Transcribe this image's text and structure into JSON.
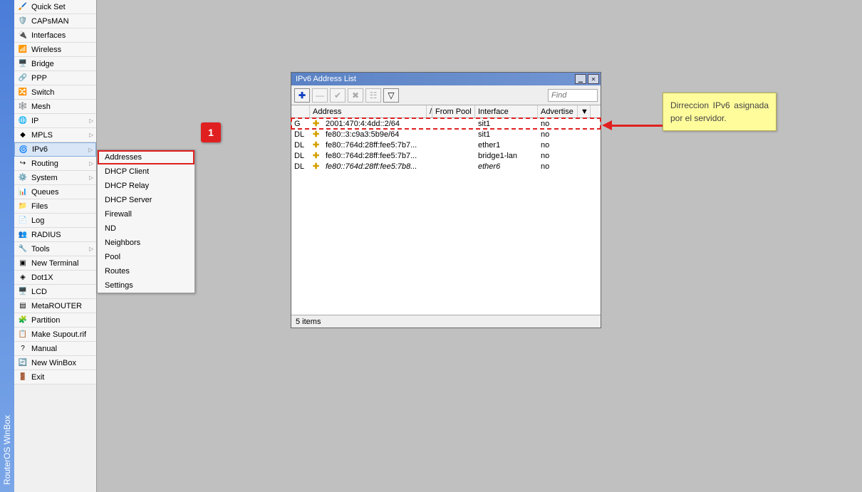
{
  "app_title": "RouterOS WinBox",
  "menu": {
    "items": [
      {
        "label": "Quick Set",
        "icon": "🖌️",
        "arrow": false
      },
      {
        "label": "CAPsMAN",
        "icon": "🛡️",
        "arrow": false
      },
      {
        "label": "Interfaces",
        "icon": "🔌",
        "arrow": false
      },
      {
        "label": "Wireless",
        "icon": "📶",
        "arrow": false
      },
      {
        "label": "Bridge",
        "icon": "🖥️",
        "arrow": false
      },
      {
        "label": "PPP",
        "icon": "🔗",
        "arrow": false
      },
      {
        "label": "Switch",
        "icon": "🔀",
        "arrow": false
      },
      {
        "label": "Mesh",
        "icon": "🕸️",
        "arrow": false
      },
      {
        "label": "IP",
        "icon": "🌐",
        "arrow": true
      },
      {
        "label": "MPLS",
        "icon": "◆",
        "arrow": true
      },
      {
        "label": "IPv6",
        "icon": "🌀",
        "arrow": true
      },
      {
        "label": "Routing",
        "icon": "↪",
        "arrow": true
      },
      {
        "label": "System",
        "icon": "⚙️",
        "arrow": true
      },
      {
        "label": "Queues",
        "icon": "📊",
        "arrow": false
      },
      {
        "label": "Files",
        "icon": "📁",
        "arrow": false
      },
      {
        "label": "Log",
        "icon": "📄",
        "arrow": false
      },
      {
        "label": "RADIUS",
        "icon": "👥",
        "arrow": false
      },
      {
        "label": "Tools",
        "icon": "🔧",
        "arrow": true
      },
      {
        "label": "New Terminal",
        "icon": "▣",
        "arrow": false
      },
      {
        "label": "Dot1X",
        "icon": "◈",
        "arrow": false
      },
      {
        "label": "LCD",
        "icon": "🖥️",
        "arrow": false
      },
      {
        "label": "MetaROUTER",
        "icon": "▤",
        "arrow": false
      },
      {
        "label": "Partition",
        "icon": "🧩",
        "arrow": false
      },
      {
        "label": "Make Supout.rif",
        "icon": "📋",
        "arrow": false
      },
      {
        "label": "Manual",
        "icon": "?",
        "arrow": false
      },
      {
        "label": "New WinBox",
        "icon": "🔄",
        "arrow": false
      },
      {
        "label": "Exit",
        "icon": "🚪",
        "arrow": false
      }
    ]
  },
  "submenu": {
    "items": [
      "Addresses",
      "DHCP Client",
      "DHCP Relay",
      "DHCP Server",
      "Firewall",
      "ND",
      "Neighbors",
      "Pool",
      "Routes",
      "Settings"
    ]
  },
  "marker": "1",
  "window": {
    "title": "IPv6 Address List",
    "find_placeholder": "Find",
    "columns": {
      "address": "Address",
      "from_pool": "From Pool",
      "interface": "Interface",
      "advertise": "Advertise"
    },
    "toolbar": {
      "add": "✚",
      "remove": "—",
      "enable": "✔",
      "disable": "✖",
      "comment": "☷",
      "filter": "▽"
    },
    "rows": [
      {
        "flag": "G",
        "address": "2001:470:4:4dd::2/64",
        "from_pool": "",
        "interface": "sit1",
        "advertise": "no",
        "highlight": true,
        "italic": false
      },
      {
        "flag": "DL",
        "address": "fe80::3:c9a3:5b9e/64",
        "from_pool": "",
        "interface": "sit1",
        "advertise": "no",
        "highlight": false,
        "italic": false
      },
      {
        "flag": "DL",
        "address": "fe80::764d:28ff:fee5:7b7...",
        "from_pool": "",
        "interface": "ether1",
        "advertise": "no",
        "highlight": false,
        "italic": false
      },
      {
        "flag": "DL",
        "address": "fe80::764d:28ff:fee5:7b7...",
        "from_pool": "",
        "interface": "bridge1-lan",
        "advertise": "no",
        "highlight": false,
        "italic": false
      },
      {
        "flag": "DL",
        "address": "fe80::764d:28ff:fee5:7b8...",
        "from_pool": "",
        "interface": "ether6",
        "advertise": "no",
        "highlight": false,
        "italic": true
      }
    ],
    "status": "5 items"
  },
  "annotation": "Dirreccion IPv6 asignada por el servidor."
}
